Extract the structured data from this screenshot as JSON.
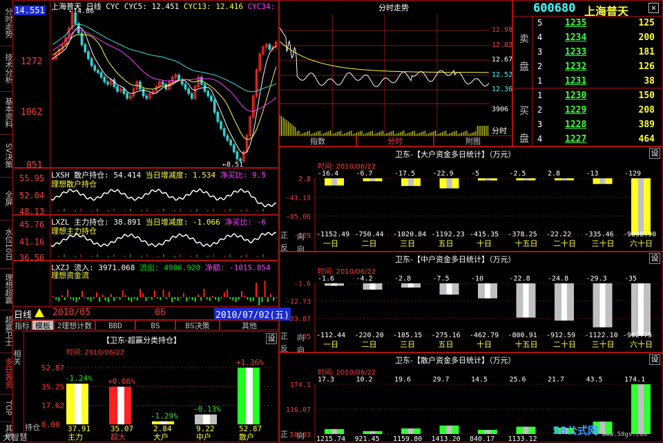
{
  "side_tabs": [
    "分时走势",
    "技术分析",
    "基本资料",
    "SV决策",
    "全屏",
    "水位10日",
    "理想超赢",
    "超赢卫士",
    "多日各资",
    "TOP",
    "其他"
  ],
  "side_tabs_bottom": [
    "相关",
    "大智慧"
  ],
  "kline": {
    "header": "上海普天 日线  CYC  CYC5: 12.451",
    "cyc13": "CYC13: 12.416",
    "cyc34": "CYC34:",
    "price_box": "14.551",
    "y_labels": [
      "1272",
      "1062",
      "851"
    ],
    "max_label": "14.86",
    "min_label": "8.51",
    "price_series": [
      12.9,
      13.1,
      13.3,
      13.5,
      13.8,
      14.2,
      14.86,
      14.4,
      14.0,
      13.5,
      13.2,
      12.9,
      12.6,
      12.4,
      12.3,
      12.1,
      11.9,
      11.8,
      12.0,
      11.7,
      11.5,
      11.6,
      11.4,
      11.2,
      11.3,
      11.6,
      11.9,
      11.6,
      11.3,
      11.2,
      11.4,
      11.5,
      11.7,
      11.9,
      11.8,
      11.6,
      11.9,
      12.1,
      12.2,
      12.0,
      11.8,
      11.6,
      11.4,
      11.2,
      11.7,
      12.1,
      11.8,
      11.5,
      11.3,
      11.1,
      10.6,
      10.2,
      9.9,
      9.6,
      9.4,
      9.2,
      8.9,
      8.6,
      8.51,
      8.9,
      9.6,
      10.4,
      11.3,
      12.4,
      13.1,
      13.4,
      13.5,
      13.3,
      13.4,
      13.6
    ]
  },
  "ind1": {
    "header_a": "LXSH 散户持仓: 54.414",
    "header_b": "当日增减度: 1.534",
    "header_c": "净买比: 9.5",
    "title": "理想散户持仓",
    "y_labels": [
      "55.95",
      "52.04",
      "48.13"
    ]
  },
  "ind2": {
    "header_a": "LXZL 主力持仓: 38.891",
    "header_b": "当日增减度: -1.066",
    "header_c": "净买比: -6",
    "title": "理想主力持仓",
    "y_labels": [
      "45.76",
      "41.16",
      "36.56"
    ]
  },
  "ind3": {
    "header_a": "LXZJ 流入: 3971.068",
    "header_b": "流出: 4986.920",
    "header_c": "净额: -1015.854",
    "title": "理想资金流"
  },
  "status": {
    "period": "日线",
    "date_left": "2010/05",
    "mid": "06",
    "date_right": "2010/07/02(五)"
  },
  "tabs_bar": [
    "指标",
    "模板",
    "2理想计数",
    "BBD",
    "BS",
    "BS决策",
    "其他"
  ],
  "holdings": {
    "title": "【卫东-超赢分类持仓】",
    "set_label": "设",
    "time_label": "时间: 2010/06/22",
    "y_labels": [
      "52.87",
      "35.25",
      "17.62",
      "0.00"
    ],
    "bars": [
      {
        "name": "主力",
        "value": "37.91",
        "change": "-1.24%",
        "pct": 37.91
      },
      {
        "name": "超大",
        "value": "35.07",
        "change": "+0.06%",
        "pct": 35.07
      },
      {
        "name": "大户",
        "value": "2.84",
        "change": "-1.29%",
        "pct": 2.84
      },
      {
        "name": "中户",
        "value": "9.22",
        "change": "-0.13%",
        "pct": 9.22
      },
      {
        "name": "散户",
        "value": "52.87",
        "change": "+1.36%",
        "pct": 52.87
      }
    ],
    "legend": "持仓"
  },
  "minute": {
    "title": "分时走势",
    "right_labels": [
      "12.98",
      "12.82",
      "12.67",
      "12.52",
      "12.36"
    ],
    "vol_label": "3906",
    "vol_unit": "分时",
    "tabs": [
      "指数",
      "分时",
      "附图"
    ]
  },
  "quote": {
    "code": "600680",
    "name": "上海普天",
    "close": "☒",
    "sell_label": [
      "卖",
      "盘"
    ],
    "buy_label": [
      "买",
      "盘"
    ],
    "asks": [
      {
        "lvl": "5",
        "price": "1235",
        "vol": "125"
      },
      {
        "lvl": "4",
        "price": "1234",
        "vol": "200"
      },
      {
        "lvl": "3",
        "price": "1233",
        "vol": "181"
      },
      {
        "lvl": "2",
        "price": "1232",
        "vol": "126"
      },
      {
        "lvl": "1",
        "price": "1231",
        "vol": "38"
      }
    ],
    "bids": [
      {
        "lvl": "1",
        "price": "1230",
        "vol": "150"
      },
      {
        "lvl": "2",
        "price": "1229",
        "vol": "208"
      },
      {
        "lvl": "3",
        "price": "1228",
        "vol": "389"
      },
      {
        "lvl": "4",
        "price": "1227",
        "vol": "464"
      }
    ]
  },
  "big_funds": {
    "title": "卫东-【大户资金多日统计】（万元）",
    "time": "时间: 2010/06/22",
    "set_label": "设",
    "side_labels": [
      "正",
      "向",
      "反",
      "向"
    ],
    "y_labels": [
      "2.8",
      "-41.13",
      "-85.06",
      "-129"
    ],
    "top_values": [
      "-16.4",
      "-6.7",
      "-17.5",
      "-22.9",
      "-5",
      "-2.5",
      "2.8",
      "-13",
      "-129"
    ],
    "bottom_values": [
      "-1152.49",
      "-750.44",
      "-1020.84",
      "-1192.23",
      "-415.35",
      "-378.25",
      "-22.22",
      "-335.46",
      "-9898.90"
    ],
    "days": [
      "一日",
      "二日",
      "三日",
      "五日",
      "十日",
      "十五日",
      "二十日",
      "三十日",
      "六十日"
    ],
    "bar_values": [
      -16.4,
      -6.7,
      -17.5,
      -22.9,
      -5,
      -2.5,
      2.8,
      -13,
      -129
    ]
  },
  "mid_funds": {
    "title": "卫东-【中户资金多日统计】（万元）",
    "time": "时间: 2010/06/22",
    "set_label": "设",
    "side_labels": [
      "正",
      "向",
      "反",
      "向"
    ],
    "y_labels": [
      "-1.6",
      "-12.73",
      "-23.87",
      "-35"
    ],
    "top_values": [
      "-1.6",
      "-4.2",
      "-2.8",
      "-7.5",
      "-10",
      "-22.8",
      "-24.8",
      "-29.3",
      "-35"
    ],
    "bottom_values": [
      "-112.44",
      "-220.20",
      "-185.15",
      "-275.16",
      "-462.79",
      "-800.91",
      "-912.59",
      "-1122.10",
      "-902.75"
    ],
    "days": [
      "一日",
      "二日",
      "三日",
      "五日",
      "十日",
      "十五日",
      "二十日",
      "三十日",
      "六十日"
    ],
    "bar_values": [
      -1.6,
      -4.2,
      -2.8,
      -7.5,
      -10,
      -22.8,
      -24.8,
      -29.3,
      -35
    ]
  },
  "retail_funds": {
    "title": "卫东-【散户资金多日统计】（万元）",
    "time": "时间: 2010/06/22",
    "set_label": "设",
    "side_labels": [
      "正",
      "向"
    ],
    "y_labels": [
      "174.1",
      "116.07",
      "58.03"
    ],
    "top_values": [
      "17.3",
      "10.2",
      "19.6",
      "29.7",
      "14.5",
      "25.6",
      "21.7",
      "43.5",
      "174.1"
    ],
    "bottom_values": [
      "1215.74",
      "921.45",
      "1159.80",
      "1413.20",
      "840.17",
      "1133.12",
      "",
      "",
      ""
    ],
    "bar_values": [
      17.3,
      10.2,
      19.6,
      29.7,
      14.5,
      25.6,
      21.7,
      43.5,
      174.1
    ]
  },
  "watermark": "58公式网",
  "watermark_url": "www.58gs.com"
}
